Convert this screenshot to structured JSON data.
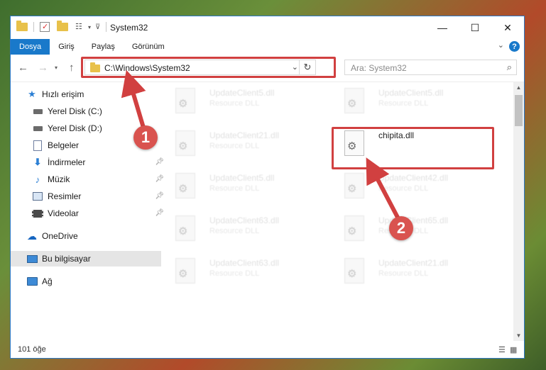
{
  "window": {
    "title": "System32"
  },
  "ribbon": {
    "tabs": [
      {
        "label": "Dosya",
        "active": true
      },
      {
        "label": "Giriş"
      },
      {
        "label": "Paylaş"
      },
      {
        "label": "Görünüm"
      }
    ],
    "help_label": "?"
  },
  "address_bar": {
    "path": "C:\\Windows\\System32"
  },
  "search": {
    "placeholder": "Ara: System32"
  },
  "sidebar": {
    "items": [
      {
        "label": "Hızlı erişim",
        "icon": "star-icon",
        "pinned": false
      },
      {
        "label": "Yerel Disk (C:)",
        "icon": "drive-icon",
        "pinned": false
      },
      {
        "label": "Yerel Disk (D:)",
        "icon": "drive-icon",
        "pinned": false
      },
      {
        "label": "Belgeler",
        "icon": "documents-icon",
        "pinned": false
      },
      {
        "label": "İndirmeler",
        "icon": "download-icon",
        "pinned": true
      },
      {
        "label": "Müzik",
        "icon": "music-icon",
        "pinned": true
      },
      {
        "label": "Resimler",
        "icon": "pictures-icon",
        "pinned": true
      },
      {
        "label": "Videolar",
        "icon": "video-icon",
        "pinned": true
      },
      {
        "label": "OneDrive",
        "icon": "cloud-icon",
        "pinned": false
      },
      {
        "label": "Bu bilgisayar",
        "icon": "computer-icon",
        "pinned": false,
        "selected": true
      },
      {
        "label": "Ağ",
        "icon": "network-icon",
        "pinned": false
      }
    ]
  },
  "files": [
    {
      "name": "UpdateClient5.dll",
      "type": "Resource DLL"
    },
    {
      "name": "UpdateClient5.dll",
      "type": "Resource DLL"
    },
    {
      "name": "UpdateClient21.dll",
      "type": "Resource DLL"
    },
    {
      "name": "chipita.dll",
      "type": ""
    },
    {
      "name": "UpdateClient5.dll",
      "type": "Resource DLL"
    },
    {
      "name": "UpdateClient42.dll",
      "type": "Resource DLL"
    },
    {
      "name": "UpdateClient63.dll",
      "type": "Resource DLL"
    },
    {
      "name": "UpdateClient65.dll",
      "type": "Resource DLL"
    },
    {
      "name": "UpdateClient63.dll",
      "type": "Resource DLL"
    },
    {
      "name": "UpdateClient21.dll",
      "type": "Resource DLL"
    }
  ],
  "status": {
    "item_count": "101 öğe"
  },
  "annotations": {
    "step1": "1",
    "step2": "2",
    "color": "#d14040"
  },
  "colors": {
    "accent": "#1979ca",
    "annotation": "#d14040"
  }
}
